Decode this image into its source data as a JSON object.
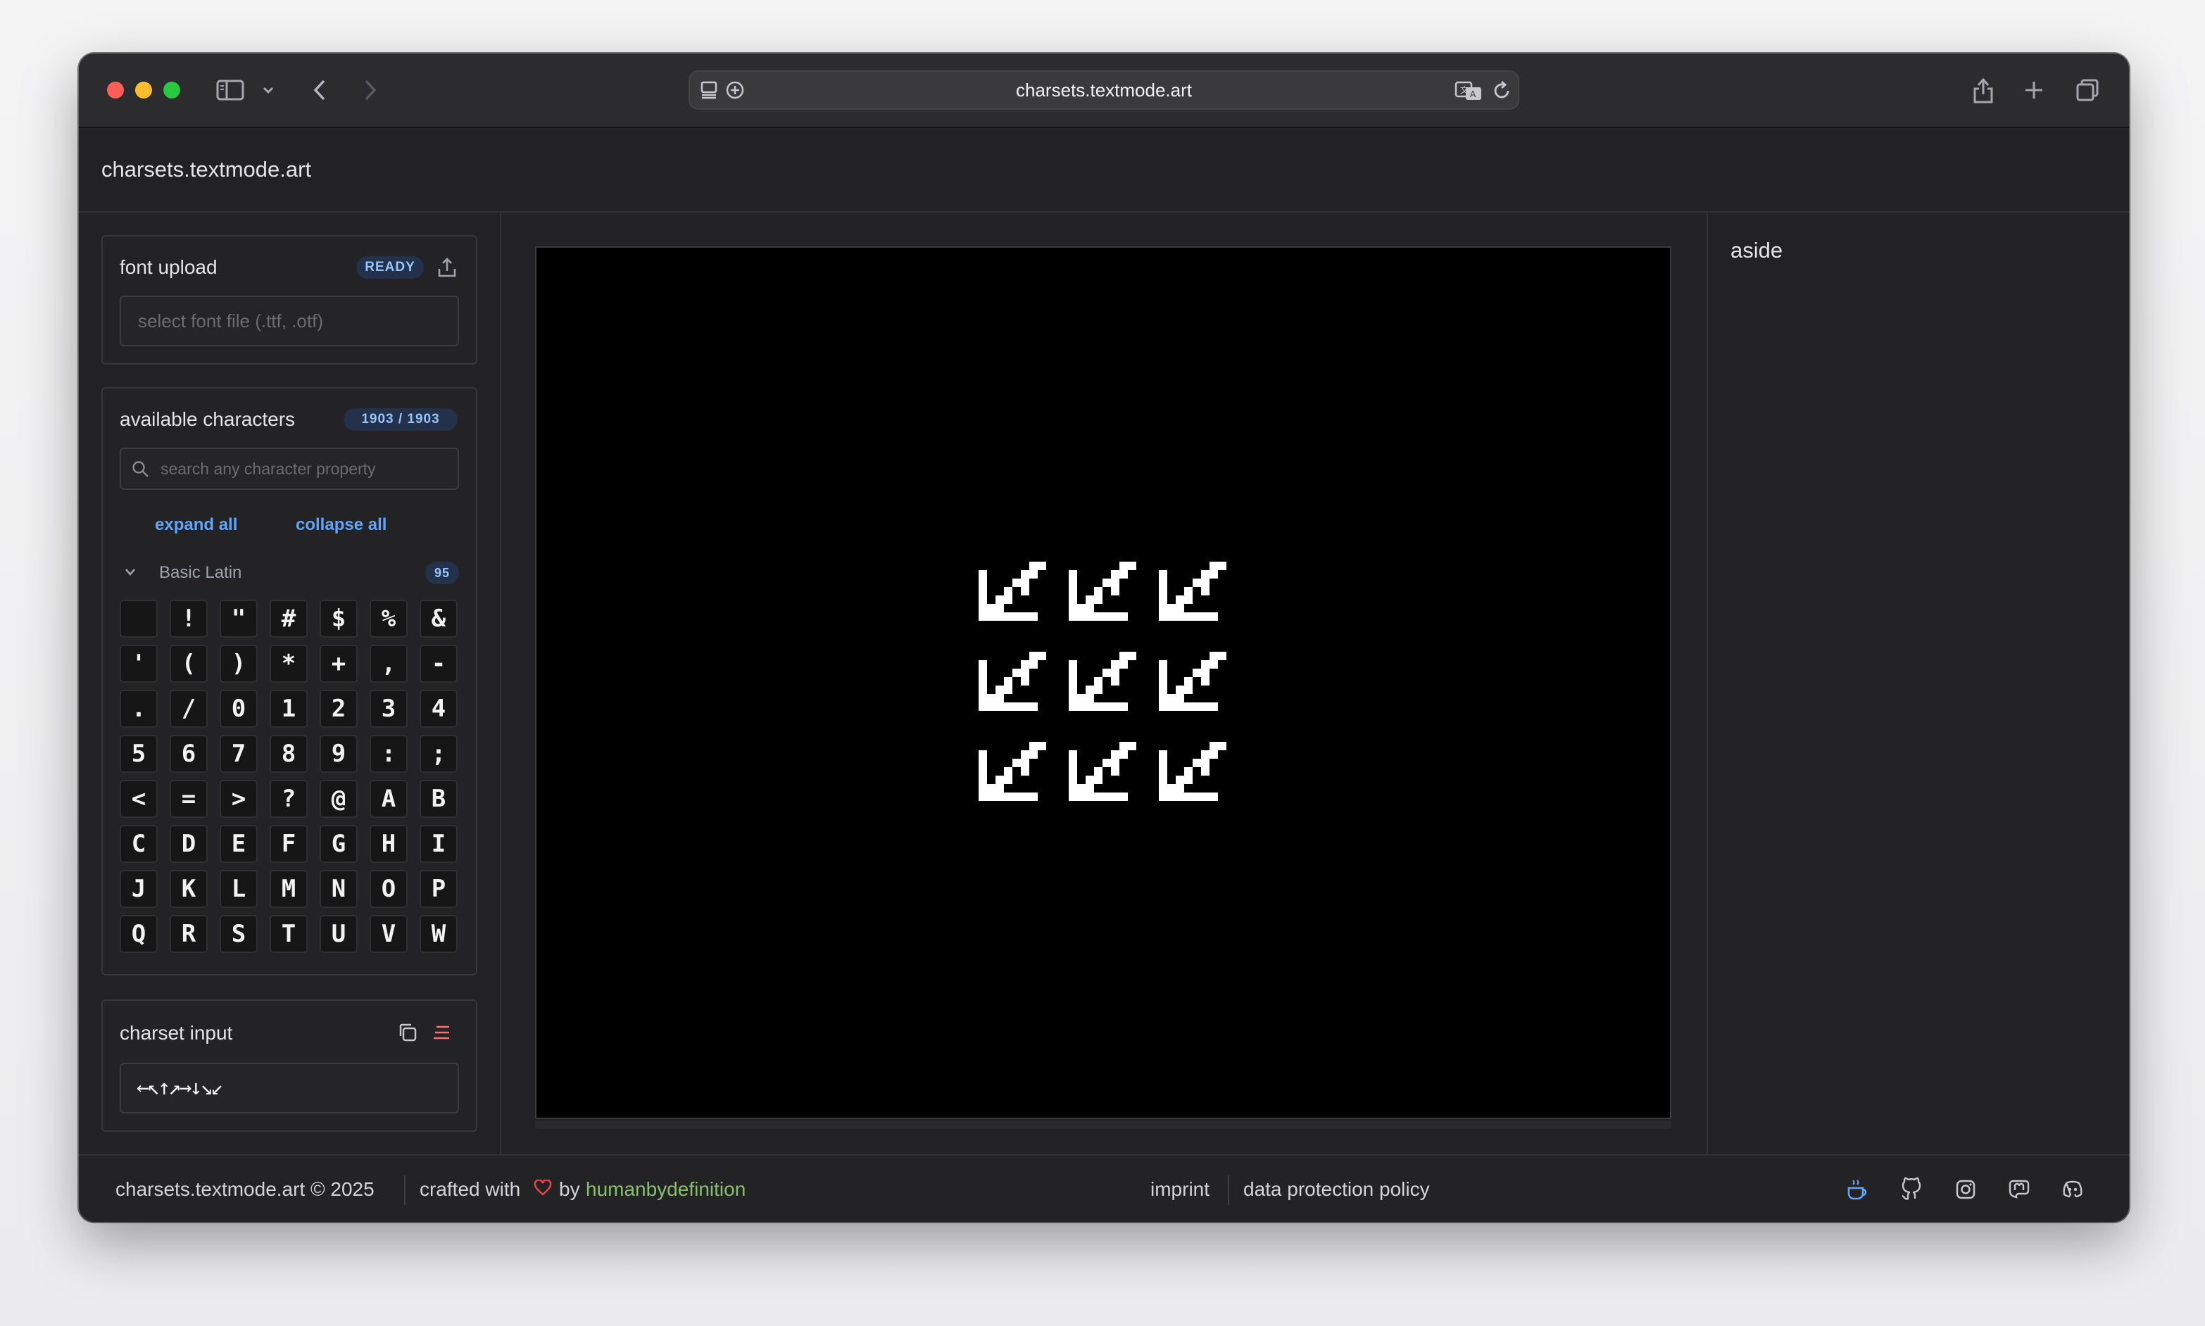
{
  "browser": {
    "url": "charsets.textmode.art",
    "traffic_lights": {
      "close": "#ff5f57",
      "minimize": "#febc2e",
      "zoom": "#28c840"
    }
  },
  "site": {
    "title": "charsets.textmode.art"
  },
  "font_upload": {
    "title": "font upload",
    "status": "READY",
    "placeholder": "select font file (.ttf, .otf)"
  },
  "characters": {
    "title": "available characters",
    "count": "1903 / 1903",
    "search_placeholder": "search any character property",
    "expand_all": "expand all",
    "collapse_all": "collapse all",
    "group": {
      "name": "Basic Latin",
      "count": "95"
    },
    "glyphs": [
      " ",
      "!",
      "\"",
      "#",
      "$",
      "%",
      "&",
      "'",
      "(",
      ")",
      "*",
      "+",
      ",",
      "-",
      ".",
      "/",
      "0",
      "1",
      "2",
      "3",
      "4",
      "5",
      "6",
      "7",
      "8",
      "9",
      ":",
      ";",
      "<",
      "=",
      ">",
      "?",
      "@",
      "A",
      "B",
      "C",
      "D",
      "E",
      "F",
      "G",
      "H",
      "I",
      "J",
      "K",
      "L",
      "M",
      "N",
      "O",
      "P",
      "Q",
      "R",
      "S",
      "T",
      "U",
      "V",
      "W"
    ]
  },
  "charset_input": {
    "title": "charset input",
    "value": "←↖↑↗→↓↘↙"
  },
  "aside": {
    "title": "aside"
  },
  "footer": {
    "copyright": "charsets.textmode.art © 2025",
    "crafted_prefix": "crafted with",
    "crafted_by": "by",
    "author": "humanbydefinition",
    "imprint": "imprint",
    "privacy": "data protection policy",
    "accent": "#86c06c",
    "heart_color": "#ef4444"
  }
}
